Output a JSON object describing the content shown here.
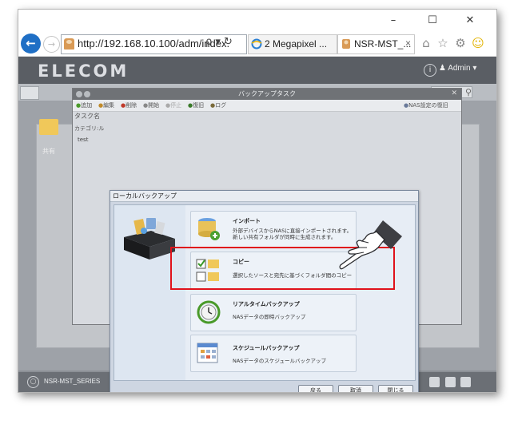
{
  "window": {
    "minimize": "–",
    "maximize": "☐",
    "close": "✕"
  },
  "address_bar": {
    "url": "http://192.168.10.100/adm/index.",
    "controls": "ρ ▾ ↻"
  },
  "tabs": [
    {
      "label": "2 Megapixel ...",
      "close": ""
    },
    {
      "label": "NSR-MST_...",
      "close": "×"
    }
  ],
  "app": {
    "logo": "ELECOM",
    "admin_label": "Admin",
    "desktop_icon_label": "共有",
    "footer_label": "NSR-MST_SERIES"
  },
  "backup_task": {
    "title": "バックアップタスク",
    "toolbar": [
      "追加",
      "編集",
      "削除",
      "開始",
      "停止",
      "復旧",
      "ログ"
    ],
    "nas_settings": "NAS設定の復旧",
    "column_header": "タスク名",
    "category": "カテゴリ:ル",
    "row": "test"
  },
  "local_backup": {
    "title": "ローカルバックアップ",
    "options": [
      {
        "title": "インポート",
        "desc": "外部デバイスからNASに直接インポートされます。新しい共有フォルダが同時に生成されます。"
      },
      {
        "title": "コピー",
        "desc": "選択したソースと宛先に基づくフォルダ間のコピー"
      },
      {
        "title": "リアルタイムバックアップ",
        "desc": "NASデータの即時バックアップ"
      },
      {
        "title": "スケジュールバックアップ",
        "desc": "NASデータのスケジュールバックアップ"
      }
    ],
    "buttons": {
      "back": "戻る",
      "cancel": "取消",
      "close": "閉じる"
    }
  },
  "colors": {
    "highlight": "#e0121b",
    "header": "#5a5e64",
    "back_button": "#1f6fc5"
  }
}
